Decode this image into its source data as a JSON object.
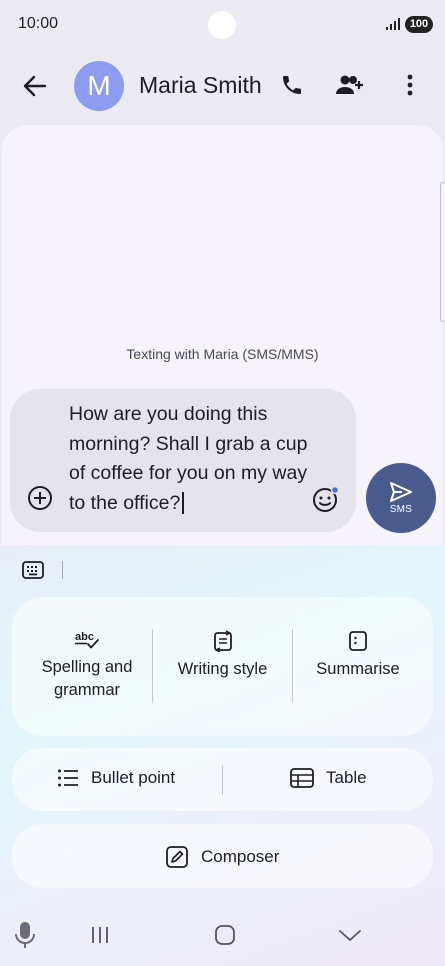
{
  "status_bar": {
    "time": "10:00",
    "battery": "100"
  },
  "header": {
    "avatar_letter": "M",
    "contact_name": "Maria Smith"
  },
  "conversation": {
    "info_text": "Texting with Maria (SMS/MMS)"
  },
  "compose": {
    "message": "How are you doing this morning? Shall I grab a cup of coffee for you on my way to the office?",
    "send_label": "SMS"
  },
  "ai_tools": {
    "spelling_label": "Spelling and grammar",
    "spelling_icon_text": "abc",
    "style_label": "Writing style",
    "summarise_label": "Summarise",
    "bullet_label": "Bullet point",
    "table_label": "Table",
    "composer_label": "Composer"
  },
  "colors": {
    "send_button": "#4A5C8E",
    "avatar": "#8C9CF0"
  },
  "icons": [
    "back-arrow-icon",
    "phone-icon",
    "add-person-icon",
    "more-vert-icon",
    "add-circle-icon",
    "emoji-icon",
    "send-icon",
    "keyboard-icon",
    "spellcheck-icon",
    "writing-style-icon",
    "summarise-icon",
    "bullet-list-icon",
    "table-icon",
    "edit-icon",
    "microphone-icon",
    "recents-icon",
    "home-icon",
    "collapse-icon"
  ]
}
